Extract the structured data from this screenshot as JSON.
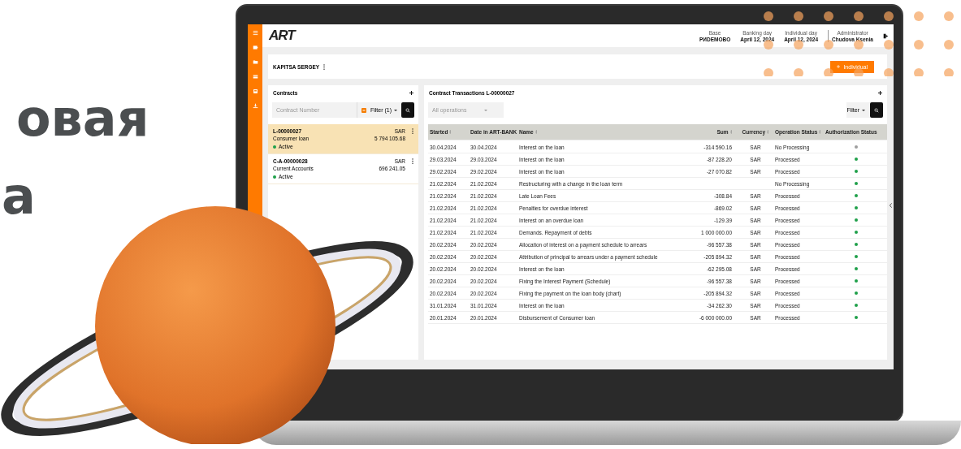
{
  "headline": [
    "овая",
    "а"
  ],
  "app": {
    "logo": "ART",
    "header_info": [
      {
        "label": "Base",
        "value": "PИDEMOBO"
      },
      {
        "label": "Banking day",
        "value": "April 12, 2024"
      },
      {
        "label": "Individual day",
        "value": "April 12, 2024"
      },
      {
        "label": "Administrator",
        "value": "Chudova Ksenia"
      }
    ],
    "client": {
      "name": "KAPITSA SERGEY",
      "button": "Individual"
    },
    "contracts": {
      "title": "Contracts",
      "search": {
        "placeholder": "Contract Number"
      },
      "filter": "Filter (1)",
      "items": [
        {
          "number": "L-00000027",
          "type": "Consumer loan",
          "status": "Active",
          "currency": "SAR",
          "amount": "5 794 105.68",
          "selected": true
        },
        {
          "number": "C-A-00000028",
          "type": "Current Accounts",
          "status": "Active",
          "currency": "SAR",
          "amount": "696 241.05",
          "selected": false
        }
      ]
    },
    "transactions": {
      "title": "Contract Transactions L-00000027",
      "operations": {
        "placeholder": "All operations"
      },
      "filter": "Filter",
      "columns": [
        "Started",
        "Date in ART-BANK",
        "Name",
        "Sum",
        "Currency",
        "Operation Status",
        "Authorization Status"
      ],
      "rows": [
        {
          "started": "30.04.2024",
          "date": "30.04.2024",
          "name": "Interest on the loan",
          "sum": "-314 590.16",
          "currency": "SAR",
          "status": "No Processing",
          "color": "#9e9e9e"
        },
        {
          "started": "29.03.2024",
          "date": "29.03.2024",
          "name": "Interest on the loan",
          "sum": "-87 228.20",
          "currency": "SAR",
          "status": "Processed",
          "color": "#1fa04a"
        },
        {
          "started": "29.02.2024",
          "date": "29.02.2024",
          "name": "Interest on the loan",
          "sum": "-27 070.82",
          "currency": "SAR",
          "status": "Processed",
          "color": "#1fa04a"
        },
        {
          "started": "21.02.2024",
          "date": "21.02.2024",
          "name": "Restructuring with a change in the loan term",
          "status": "No Processing",
          "color": "#1fa04a"
        },
        {
          "started": "21.02.2024",
          "date": "21.02.2024",
          "name": "Late Loan Fees",
          "sum": "-308.84",
          "currency": "SAR",
          "status": "Processed",
          "color": "#1fa04a"
        },
        {
          "started": "21.02.2024",
          "date": "21.02.2024",
          "name": "Penalties for overdue interest",
          "sum": "-869.02",
          "currency": "SAR",
          "status": "Processed",
          "color": "#1fa04a"
        },
        {
          "started": "21.02.2024",
          "date": "21.02.2024",
          "name": "Interest on an overdue loan",
          "sum": "-129.39",
          "currency": "SAR",
          "status": "Processed",
          "color": "#1fa04a"
        },
        {
          "started": "21.02.2024",
          "date": "21.02.2024",
          "name": "Demands. Repayment of debts",
          "sum": "1 000 000.00",
          "currency": "SAR",
          "status": "Processed",
          "color": "#1fa04a"
        },
        {
          "started": "20.02.2024",
          "date": "20.02.2024",
          "name": "Allocation of interest on a payment schedule to arrears",
          "sum": "-96 557.38",
          "currency": "SAR",
          "status": "Processed",
          "color": "#1fa04a"
        },
        {
          "started": "20.02.2024",
          "date": "20.02.2024",
          "name": "Attribution of principal to arrears under a payment schedule",
          "sum": "-205 894.32",
          "currency": "SAR",
          "status": "Processed",
          "color": "#1fa04a"
        },
        {
          "started": "20.02.2024",
          "date": "20.02.2024",
          "name": "Interest on the loan",
          "sum": "-62 295.08",
          "currency": "SAR",
          "status": "Processed",
          "color": "#1fa04a"
        },
        {
          "started": "20.02.2024",
          "date": "20.02.2024",
          "name": "Fixing the Interest Payment (Schedule)",
          "sum": "-96 557.38",
          "currency": "SAR",
          "status": "Processed",
          "color": "#1fa04a"
        },
        {
          "started": "20.02.2024",
          "date": "20.02.2024",
          "name": "Fixing the payment on the loan body (chart)",
          "sum": "-205 894.32",
          "currency": "SAR",
          "status": "Processed",
          "color": "#1fa04a"
        },
        {
          "started": "31.01.2024",
          "date": "31.01.2024",
          "name": "Interest on the loan",
          "sum": "-34 262.30",
          "currency": "SAR",
          "status": "Processed",
          "color": "#1fa04a"
        },
        {
          "started": "20.01.2024",
          "date": "20.01.2024",
          "name": "Disbursement of Consumer loan",
          "sum": "-6 000 000.00",
          "currency": "SAR",
          "status": "Processed",
          "color": "#1fa04a"
        }
      ]
    }
  }
}
